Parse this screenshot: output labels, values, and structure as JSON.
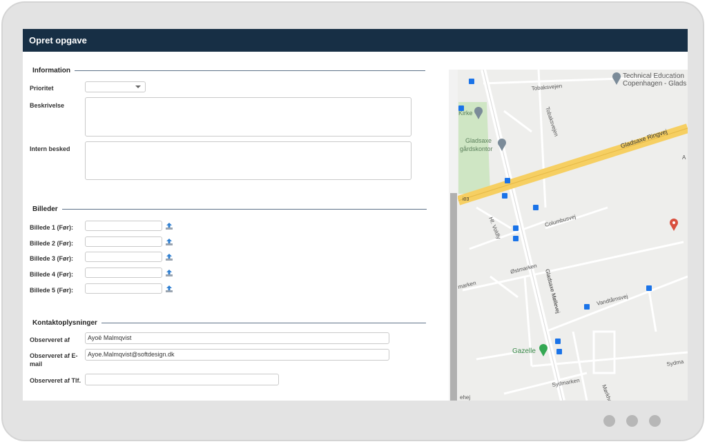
{
  "window": {
    "title": "Opret opgave"
  },
  "sections": {
    "information": "Information",
    "billeder": "Billeder",
    "kontakt": "Kontaktoplysninger"
  },
  "information": {
    "prioritet_label": "Prioritet",
    "prioritet_value": "",
    "beskrivelse_label": "Beskrivelse",
    "intern_label": "Intern besked"
  },
  "billeder": {
    "items": [
      {
        "label": "Billede 1 (Før):",
        "value": ""
      },
      {
        "label": "Billede 2 (Før):",
        "value": ""
      },
      {
        "label": "Billede 3 (Før):",
        "value": ""
      },
      {
        "label": "Billede 4 (Før):",
        "value": ""
      },
      {
        "label": "Billede 5 (Før):",
        "value": ""
      }
    ]
  },
  "kontakt": {
    "observeret_af_label": "Observeret af",
    "observeret_af_value": "Ayoë Malmqvist",
    "email_label": "Observeret af E-mail",
    "email_value": "Ayoe.Malmqvist@softdesign.dk",
    "tlf_label": "Observeret af Tlf.",
    "tlf_value": ""
  },
  "map": {
    "labels": {
      "tobaksvejen_h": "Tobaksvejen",
      "tobaksvejen_v": "Tobaksvejen",
      "technical_1": "Technical Education",
      "technical_2": "Copenhagen - Glads",
      "kirke": "Kirke",
      "gladsaxe_1": "Gladsaxe",
      "gladsaxe_2": "gårdskontor",
      "ringvej": "Gladsaxe Ringvej",
      "road_num": "i03",
      "hf_voldly": "Hf. Voldly",
      "columbusvej": "Columbusvej",
      "ostmarken": "Østmarken",
      "marken": "marken",
      "gladsaxe_mollevej": "Gladsaxe Møllevej",
      "vandtarnsvej": "Vandtårnsvej",
      "gazelle": "Gazelle",
      "sydmarken": "Sydmarken",
      "sydma": "Sydma",
      "morkho": "Mørkho",
      "ehej": "ehej",
      "a_edge": "A"
    },
    "colors": {
      "ringvej": "#f6cf62",
      "park": "#cfe6c4",
      "transit": "#1a73e8",
      "pin_red": "#d9503f",
      "pin_green": "#34a853",
      "pin_grey": "#7b8b99"
    }
  },
  "colors": {
    "titlebar": "#172f45",
    "section_line": "#5a6f86",
    "device": "#e3e3e3"
  }
}
